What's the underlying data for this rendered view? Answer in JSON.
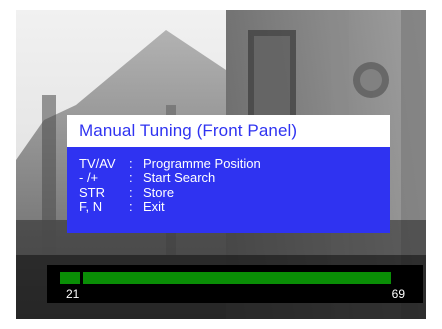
{
  "menu": {
    "title": "Manual Tuning (Front Panel)",
    "items": [
      {
        "key": "TV/AV",
        "sep": ":",
        "action": "Programme Position"
      },
      {
        "key": "- /+",
        "sep": ":",
        "action": "Start Search"
      },
      {
        "key": "STR",
        "sep": ":",
        "action": "Store"
      },
      {
        "key": "F, N",
        "sep": ":",
        "action": "Exit"
      }
    ],
    "colors": {
      "title_text": "#2f33f1",
      "title_background": "#ffffff",
      "body_background": "#2f33f1",
      "body_text": "#ffffff"
    }
  },
  "tuning": {
    "min_label": "21",
    "max_label": "69",
    "current_channel_fraction": 0.06,
    "colors": {
      "track": "#0a8e06",
      "strip_background": "#000000",
      "label_text": "#ffffff"
    }
  }
}
